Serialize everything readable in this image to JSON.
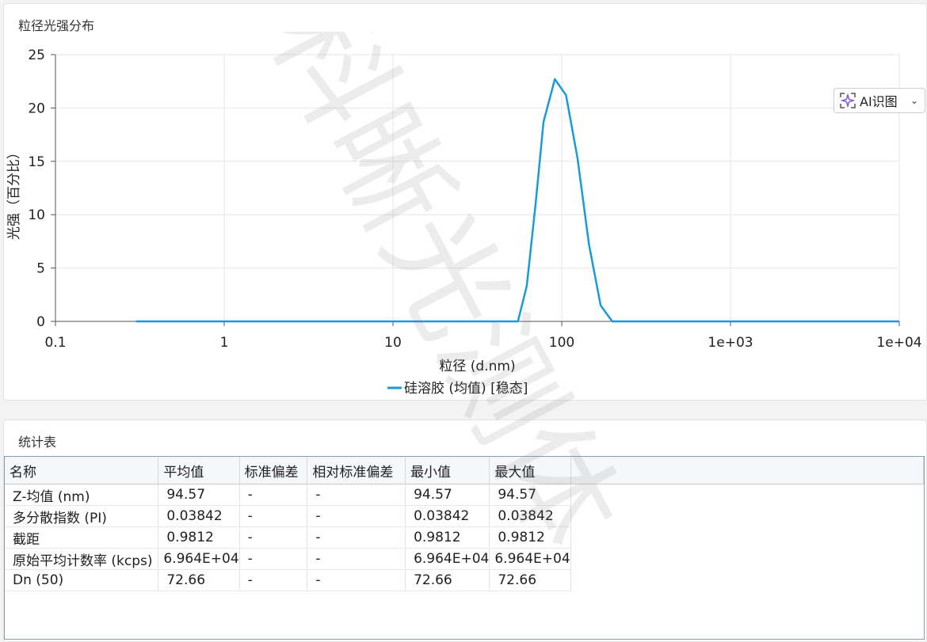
{
  "chart_panel": {
    "title": "粒径光强分布"
  },
  "ai_button": {
    "label": "AI识图"
  },
  "chart_data": {
    "type": "line",
    "xscale": "log",
    "xlabel": "粒径 (d.nm)",
    "ylabel": "光强（百分比）",
    "xlim": [
      0.1,
      10000
    ],
    "ylim": [
      0,
      25
    ],
    "xticks": [
      "0.1",
      "1",
      "10",
      "100",
      "1e+03",
      "1e+04"
    ],
    "yticks": [
      "0",
      "5",
      "10",
      "15",
      "20",
      "25"
    ],
    "grid": true,
    "legend_position": "bottom",
    "series": [
      {
        "name": "硅溶胶 (均值)  [稳态]",
        "color": "#1a9ad6",
        "x": [
          0.3,
          55,
          62,
          70,
          78,
          91,
          106,
          124,
          145,
          170,
          199,
          10000
        ],
        "y": [
          0,
          0,
          3.3,
          11,
          18.7,
          22.7,
          21.2,
          15.3,
          7.2,
          1.5,
          0,
          0
        ]
      }
    ]
  },
  "stats_panel": {
    "title": "统计表"
  },
  "table": {
    "headers": [
      "名称",
      "平均值",
      "标准偏差",
      "相对标准偏差",
      "最小值",
      "最大值"
    ],
    "rows": [
      [
        "Z-均值 (nm)",
        "94.57",
        "-",
        "-",
        "94.57",
        "94.57"
      ],
      [
        "多分散指数 (PI)",
        "0.03842",
        "-",
        "-",
        "0.03842",
        "0.03842"
      ],
      [
        "截距",
        "0.9812",
        "-",
        "-",
        "0.9812",
        "0.9812"
      ],
      [
        "原始平均计数率 (kcps)",
        "6.964E+04",
        "-",
        "-",
        "6.964E+04",
        "6.964E+04"
      ],
      [
        "Dn (50)",
        "72.66",
        "-",
        "-",
        "72.66",
        "72.66"
      ]
    ]
  },
  "watermark": {
    "text": "科晰光测体"
  }
}
